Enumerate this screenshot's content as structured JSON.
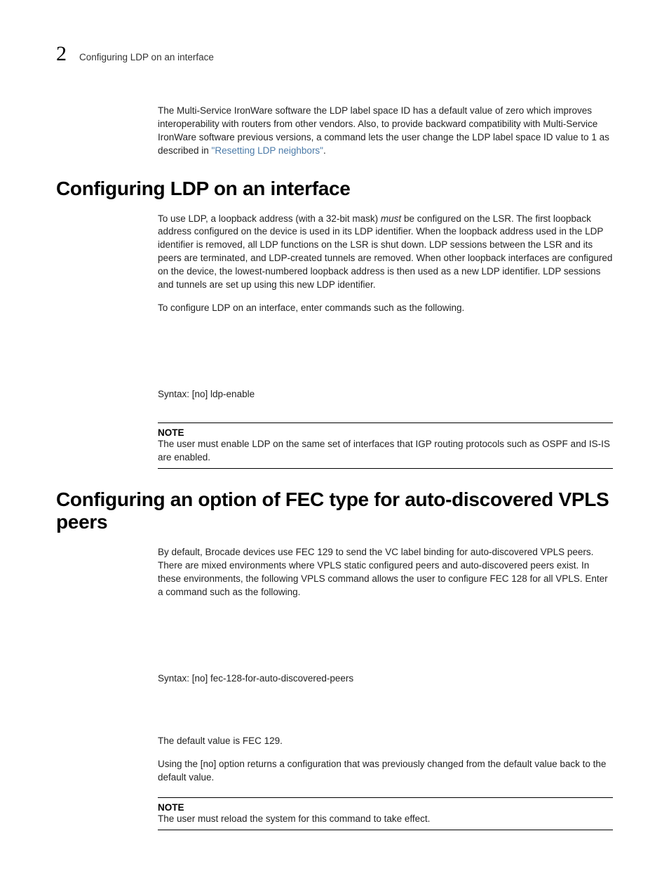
{
  "header": {
    "chapter_number": "2",
    "running_title": "Configuring LDP on an interface"
  },
  "intro_paragraph": {
    "text_before_link": "The Multi-Service IronWare software the LDP label space ID has a default value of zero which improves interoperability with routers from other vendors. Also, to provide backward compatibility with Multi-Service IronWare software previous versions, a command lets the user change the LDP label space ID value to 1 as described in ",
    "link_text": "\"Resetting LDP neighbors\"",
    "text_after_link": "."
  },
  "section1": {
    "title": "Configuring LDP on an interface",
    "p1_a": "To use LDP, a loopback address (with a 32-bit mask) ",
    "p1_must": "must",
    "p1_b": " be configured on the LSR. The first loopback address configured on the device is used in its LDP identifier. When the loopback address used in the LDP identifier is removed, all LDP functions on the LSR is shut down. LDP sessions between the LSR and its peers are terminated, and LDP-created tunnels are removed. When other loopback interfaces are configured on the device, the lowest-numbered loopback address is then used as a new LDP identifier. LDP sessions and tunnels are set up using this new LDP identifier.",
    "p2": "To configure LDP on an interface, enter commands such as the following.",
    "syntax": "Syntax:  [no] ldp-enable",
    "note_label": "NOTE",
    "note_text": "The user must enable LDP on the same set of interfaces that IGP routing protocols such as OSPF and IS-IS are enabled."
  },
  "section2": {
    "title": "Configuring an option of FEC type for auto-discovered VPLS peers",
    "p1": "By default, Brocade devices use FEC 129 to send the VC label binding for auto-discovered VPLS peers. There are mixed environments where VPLS static configured peers and auto-discovered peers exist. In these environments, the following VPLS command allows the user to configure FEC 128 for all VPLS. Enter a command such as the following.",
    "syntax": "Syntax:  [no] fec-128-for-auto-discovered-peers",
    "p2": "The default value is FEC 129.",
    "p3": "Using the [no] option returns a configuration that was previously changed from the default value back to the default value.",
    "note_label": "NOTE",
    "note_text": "The user must reload the system for this command to take effect."
  }
}
